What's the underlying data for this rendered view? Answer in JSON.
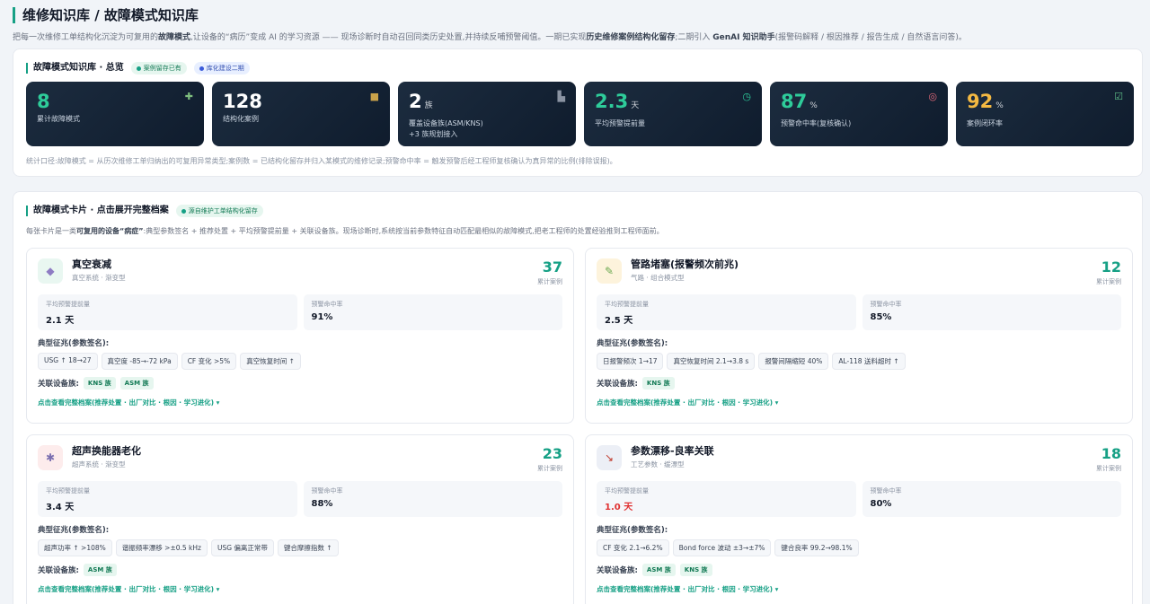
{
  "page": {
    "title": "维修知识库 / 故障模式知识库",
    "desc_1": "把每一次维修工单结构化沉淀为可复用的",
    "desc_b1": "故障模式",
    "desc_2": ",让设备的“病历”变成 AI 的学习资源 —— 现场诊断时自动召回同类历史处置,并持续反哺预警阈值。一期已实现",
    "desc_b2": "历史维修案例结构化留存",
    "desc_3": ";二期引入 ",
    "desc_b3": "GenAI 知识助手",
    "desc_4": "(报警码解释 / 根因推荐 / 报告生成 / 自然语言问答)。"
  },
  "overview": {
    "title": "故障模式知识库 · 总览",
    "tag_1": "案例留存已有",
    "tag_2": "库化建设二期",
    "kpis": [
      {
        "value": "8",
        "unit": "",
        "label": "累计故障模式",
        "sub": "",
        "icon": "puzzle-icon",
        "color": "#2ecc9a"
      },
      {
        "value": "128",
        "unit": "",
        "label": "结构化案例",
        "sub": "",
        "icon": "folder-icon",
        "color": "#ffffff"
      },
      {
        "value": "2",
        "unit": "族",
        "label": "覆盖设备族(ASM/KNS)",
        "sub": "+3 族规划接入",
        "icon": "factory-icon",
        "color": "#ffffff"
      },
      {
        "value": "2.3",
        "unit": "天",
        "label": "平均预警提前量",
        "sub": "",
        "icon": "clock-icon",
        "color": "#2ecc9a"
      },
      {
        "value": "87",
        "unit": "%",
        "label": "预警命中率(复核确认)",
        "sub": "",
        "icon": "target-icon",
        "color": "#2ecc9a"
      },
      {
        "value": "92",
        "unit": "%",
        "label": "案例闭环率",
        "sub": "",
        "icon": "check-icon",
        "color": "#f4b942"
      }
    ],
    "note": "统计口径:故障模式 = 从历次维修工单归纳出的可复用异常类型;案例数 = 已结构化留存并归入某模式的维修记录;预警命中率 = 触发预警后经工程师复核确认为真异常的比例(排除误报)。"
  },
  "cards_section": {
    "title": "故障模式卡片 · 点击展开完整档案",
    "tag": "源自维护工单结构化留存",
    "desc_1": "每张卡片是一类",
    "desc_b": "可复用的设备“病症”",
    "desc_2": ":典型参数签名 + 推荐处置 + 平均预警提前量 + 关联设备族。现场诊断时,系统按当前参数特征自动匹配最相似的故障模式,把老工程师的处置经验推到工程师面前。",
    "labels": {
      "lead": "平均预警提前量",
      "hit": "预警命中率",
      "count": "累计案例",
      "signature": "典型征兆(参数签名):",
      "equip": "关联设备族:",
      "link": "点击查看完整档案(推荐处置 · 出厂对比 · 根因 · 学习进化) ▾"
    },
    "cards": [
      {
        "name": "真空衰减",
        "meta": "真空系统 · 渐变型",
        "count": "37",
        "lead": "2.1 天",
        "lead_warn": false,
        "hit": "91%",
        "icon": "vacuum-icon",
        "icon_glyph": "◆",
        "icon_bg": "#e9f7f1",
        "icon_color": "#8e7cc3",
        "signatures": [
          "USG ↑ 18→27",
          "真空度 -85→-72 kPa",
          "CF 变化 >5%",
          "真空恢复时间 ↑"
        ],
        "equip": [
          "KNS 族",
          "ASM 族"
        ]
      },
      {
        "name": "管路堵塞(报警频次前兆)",
        "meta": "气路 · 组合模式型",
        "count": "12",
        "lead": "2.5 天",
        "lead_warn": false,
        "hit": "85%",
        "icon": "syringe-icon",
        "icon_glyph": "✎",
        "icon_bg": "#fdf3dc",
        "icon_color": "#6aa84f",
        "signatures": [
          "日报警频次 1→17",
          "真空恢复时间 2.1→3.8 s",
          "报警间隔缩短 40%",
          "AL-118 送料超时 ↑"
        ],
        "equip": [
          "KNS 族"
        ]
      },
      {
        "name": "超声换能器老化",
        "meta": "超声系统 · 渐变型",
        "count": "23",
        "lead": "3.4 天",
        "lead_warn": false,
        "hit": "88%",
        "icon": "microscope-icon",
        "icon_glyph": "✱",
        "icon_bg": "#fdecec",
        "icon_color": "#7b6fb0",
        "signatures": [
          "超声功率 ↑ >108%",
          "谐振频率漂移 >±0.5 kHz",
          "USG 偏离正常带",
          "键合摩擦指数 ↑"
        ],
        "equip": [
          "ASM 族"
        ]
      },
      {
        "name": "参数漂移-良率关联",
        "meta": "工艺参数 · 缓漂型",
        "count": "18",
        "lead": "1.0 天",
        "lead_warn": true,
        "hit": "80%",
        "icon": "chart-down-icon",
        "icon_glyph": "↘",
        "icon_bg": "#eceff6",
        "icon_color": "#c0392b",
        "signatures": [
          "CF 变化 2.1→6.2%",
          "Bond force 波动 ±3→±7%",
          "键合良率 99.2→98.1%"
        ],
        "equip": [
          "ASM 族",
          "KNS 族"
        ]
      }
    ]
  }
}
